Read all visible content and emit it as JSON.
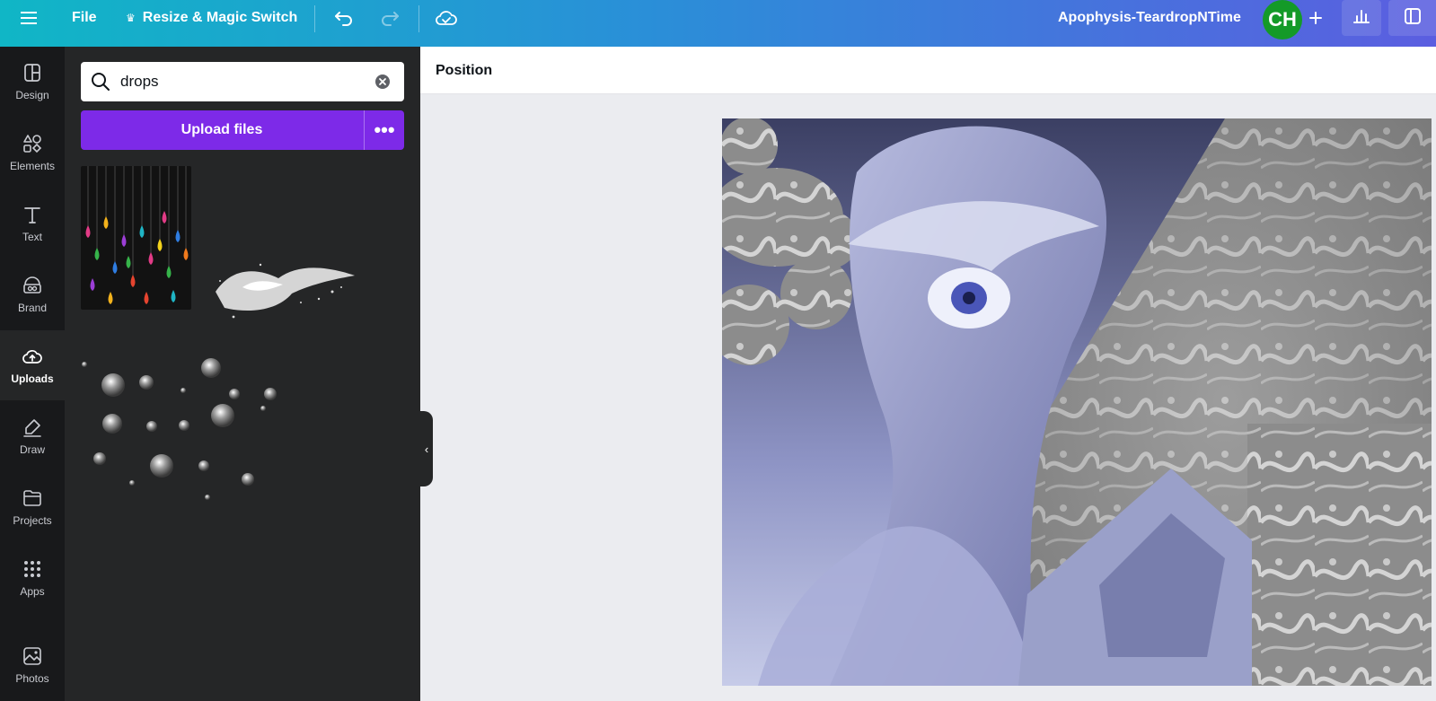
{
  "topbar": {
    "file_label": "File",
    "resize_label": "Resize & Magic Switch",
    "document_title": "Apophysis-TeardropNTime",
    "avatar_initials": "CH",
    "icons": [
      "hamburger-icon",
      "crown-icon",
      "undo-icon",
      "redo-icon",
      "cloud-saved-icon",
      "plus-icon",
      "chart-icon",
      "present-icon"
    ]
  },
  "rail": {
    "items": [
      {
        "label": "Design",
        "icon": "layout-icon"
      },
      {
        "label": "Elements",
        "icon": "shapes-icon"
      },
      {
        "label": "Text",
        "icon": "text-icon"
      },
      {
        "label": "Brand",
        "icon": "brand-icon"
      },
      {
        "label": "Uploads",
        "icon": "cloud-upload-icon",
        "active": true
      },
      {
        "label": "Draw",
        "icon": "pen-icon"
      },
      {
        "label": "Projects",
        "icon": "folder-icon"
      },
      {
        "label": "Apps",
        "icon": "grid-icon"
      },
      {
        "label": "Photos",
        "icon": "image-icon"
      }
    ]
  },
  "panel": {
    "search_value": "drops",
    "upload_label": "Upload files",
    "more_label": "•••"
  },
  "context_bar": {
    "position_label": "Position"
  },
  "colors": {
    "accent_purple": "#7d2ae8",
    "rail_bg": "#18191b",
    "panel_bg": "#252627",
    "avatar_green": "#149a28"
  }
}
